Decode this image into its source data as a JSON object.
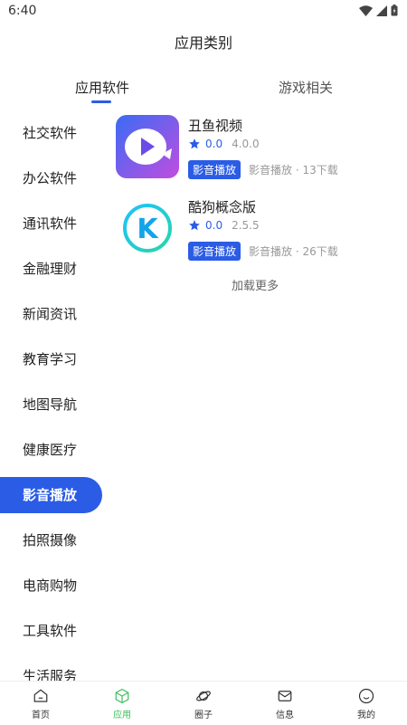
{
  "status_bar": {
    "time": "6:40"
  },
  "header": {
    "title": "应用类别"
  },
  "tabs": [
    {
      "label": "应用软件",
      "active": true
    },
    {
      "label": "游戏相关",
      "active": false
    }
  ],
  "sidebar": {
    "items": [
      {
        "label": "社交软件"
      },
      {
        "label": "办公软件"
      },
      {
        "label": "通讯软件"
      },
      {
        "label": "金融理财"
      },
      {
        "label": "新闻资讯"
      },
      {
        "label": "教育学习"
      },
      {
        "label": "地图导航"
      },
      {
        "label": "健康医疗"
      },
      {
        "label": "影音播放",
        "active": true
      },
      {
        "label": "拍照摄像"
      },
      {
        "label": "电商购物"
      },
      {
        "label": "工具软件"
      },
      {
        "label": "生活服务"
      }
    ]
  },
  "apps": [
    {
      "name": "丑鱼视频",
      "rating": "0.0",
      "version": "4.0.0",
      "tag": "影音播放",
      "meta": "影音播放 · 13下载",
      "icon": "play-fish-icon"
    },
    {
      "name": "酷狗概念版",
      "rating": "0.0",
      "version": "2.5.5",
      "tag": "影音播放",
      "meta": "影音播放 · 26下载",
      "icon": "kugou-k-icon"
    }
  ],
  "load_more": "加载更多",
  "bottom_nav": {
    "items": [
      {
        "label": "首页",
        "icon": "home-icon"
      },
      {
        "label": "应用",
        "icon": "cube-icon",
        "active": true
      },
      {
        "label": "圈子",
        "icon": "planet-icon"
      },
      {
        "label": "信息",
        "icon": "mail-icon"
      },
      {
        "label": "我的",
        "icon": "smile-icon"
      }
    ]
  },
  "colors": {
    "accent": "#2b5ce6",
    "nav_active": "#3bbf5a",
    "star": "#2b5ce6"
  }
}
